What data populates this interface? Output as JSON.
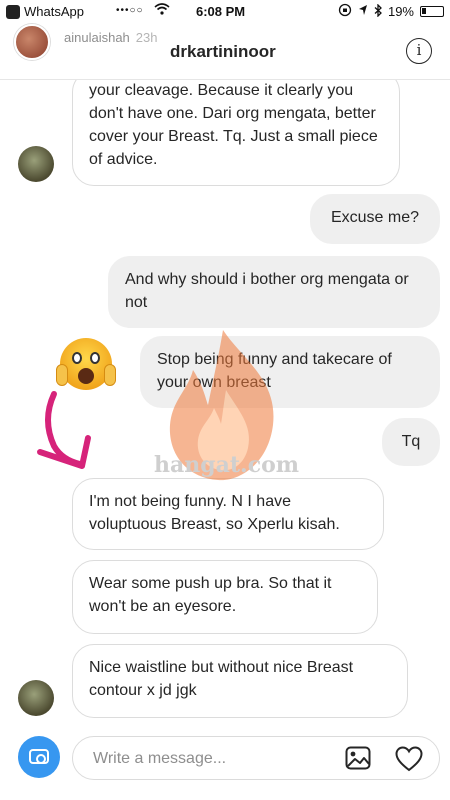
{
  "status_bar": {
    "back_app": "WhatsApp",
    "signal": "•••○○",
    "time": "6:08 PM",
    "battery": "19%"
  },
  "header": {
    "story_user": "ainulaishah",
    "story_age": "23h",
    "title": "drkartininoor",
    "info_label": "i"
  },
  "messages": [
    {
      "dir": "in",
      "text": "your cleavage. Because it clearly you don't have one. Dari org mengata, better cover your Breast. Tq. Just a small piece of advice."
    },
    {
      "dir": "out",
      "text": "Excuse me?"
    },
    {
      "dir": "out",
      "text": "And why should i bother org mengata or not"
    },
    {
      "dir": "out",
      "text": "Stop being funny and takecare of your own breast"
    },
    {
      "dir": "out",
      "text": "Tq"
    },
    {
      "dir": "in",
      "text": "I'm not being funny. N I have voluptuous Breast, so Xperlu kisah."
    },
    {
      "dir": "in",
      "text": "Wear some push up bra. So that it won't be an eyesore."
    },
    {
      "dir": "in",
      "text": "Nice waistline but without nice Breast contour x jd jgk"
    }
  ],
  "watermark": "hangat.com",
  "composer": {
    "placeholder": "Write a message..."
  },
  "colors": {
    "accent": "#3797f0",
    "arrow": "#d6237a",
    "watermark_flame": "#f07a3a"
  }
}
